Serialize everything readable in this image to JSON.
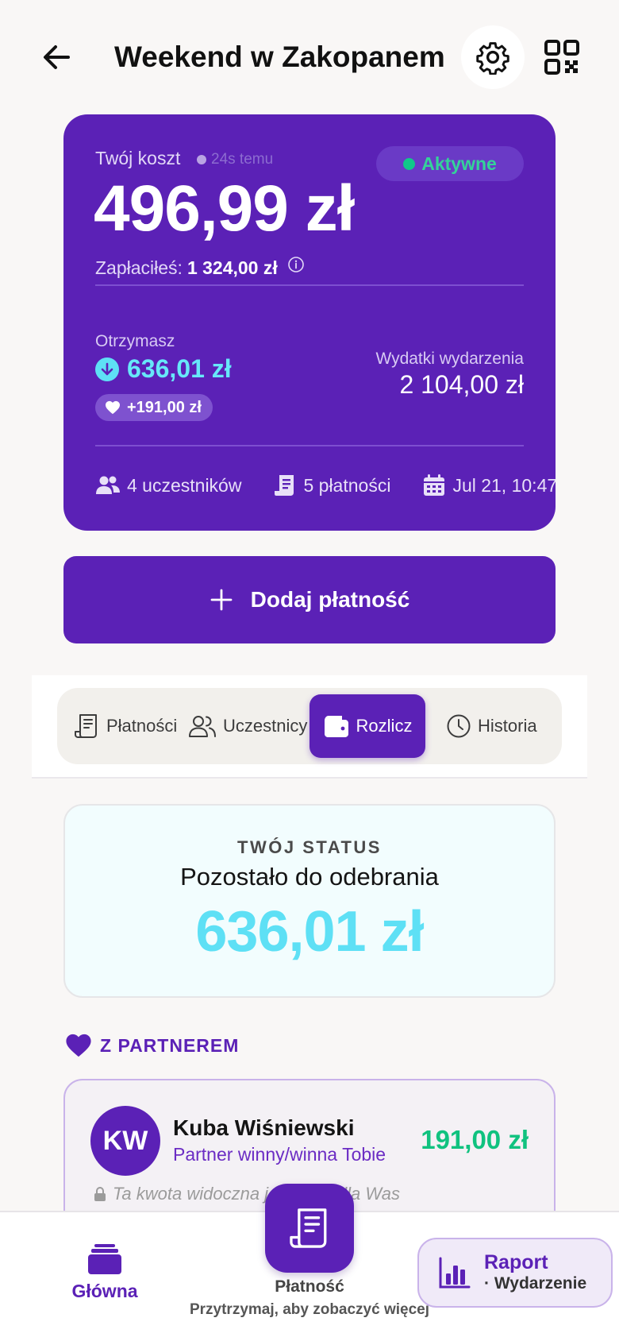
{
  "header": {
    "title": "Weekend w Zakopanem"
  },
  "summary": {
    "cost_label": "Twój koszt",
    "updated_ago": "24s temu",
    "status_badge": "Aktywne",
    "cost_value": "496,99 zł",
    "paid_label": "Zapłaciłeś:",
    "paid_value": "1 324,00 zł",
    "receive_label": "Otrzymasz",
    "receive_value": "636,01 zł",
    "partner_bonus": "+191,00 zł",
    "expenses_label": "Wydatki wydarzenia",
    "expenses_value": "2 104,00 zł",
    "participants": "4 uczestników",
    "payments": "5 płatności",
    "date": "Jul 21, 10:47"
  },
  "actions": {
    "add_payment": "Dodaj płatność"
  },
  "tabs": [
    {
      "label": "Płatności"
    },
    {
      "label": "Uczestnicy"
    },
    {
      "label": "Rozlicz"
    },
    {
      "label": "Historia"
    }
  ],
  "status": {
    "kicker": "TWÓJ STATUS",
    "title": "Pozostało do odebrania",
    "amount": "636,01 zł"
  },
  "partner": {
    "section_title": "Z PARTNEREM",
    "initials": "KW",
    "name": "Kuba Wiśniewski",
    "role": "Partner winny/winna Tobie",
    "amount": "191,00 zł",
    "note": "Ta kwota widoczna jest tylko dla Was"
  },
  "bottom_nav": {
    "home_label": "Główna",
    "payment_label": "Płatność",
    "payment_hint": "Przytrzymaj, aby zobaczyć więcej",
    "report_title": "Raport",
    "report_sub": "· Wydarzenie"
  },
  "colors": {
    "primary": "#5b21b6",
    "cyan": "#5ee0f5",
    "green": "#10c27f"
  }
}
